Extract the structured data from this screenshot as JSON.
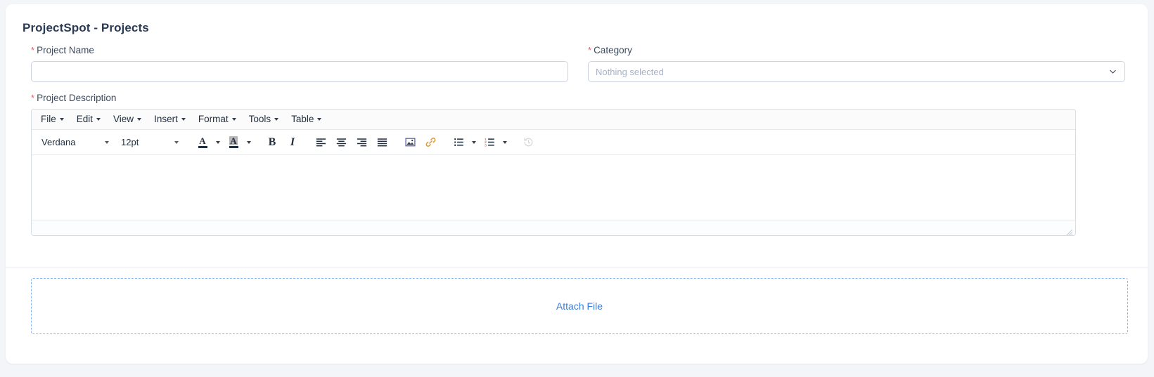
{
  "page": {
    "title": "ProjectSpot - Projects",
    "accent_blue": "#3b7ddd",
    "required_marker_color": "#e8606d",
    "dashed_border_color": "#84b6f0"
  },
  "form": {
    "project_name": {
      "label": "Project Name",
      "required_marker": "*",
      "value": "",
      "placeholder": ""
    },
    "category": {
      "label": "Category",
      "required_marker": "*",
      "selected_text": "Nothing selected",
      "caret_icon": "chevron-down-icon"
    },
    "project_description": {
      "label": "Project Description",
      "required_marker": "*"
    }
  },
  "editor": {
    "menubar": [
      {
        "label": "File",
        "caret": true
      },
      {
        "label": "Edit",
        "caret": true
      },
      {
        "label": "View",
        "caret": true
      },
      {
        "label": "Insert",
        "caret": true
      },
      {
        "label": "Format",
        "caret": true
      },
      {
        "label": "Tools",
        "caret": true
      },
      {
        "label": "Table",
        "caret": true
      }
    ],
    "toolbar": {
      "fontfamily": "Verdana",
      "fontsize": "12pt",
      "buttons": [
        {
          "name": "text-color-icon",
          "label": "A"
        },
        {
          "name": "background-color-icon",
          "label": "A"
        },
        {
          "name": "bold-icon",
          "label": "B"
        },
        {
          "name": "italic-icon",
          "label": "I"
        },
        {
          "name": "align-left-icon",
          "label": ""
        },
        {
          "name": "align-center-icon",
          "label": ""
        },
        {
          "name": "align-right-icon",
          "label": ""
        },
        {
          "name": "align-justify-icon",
          "label": ""
        },
        {
          "name": "image-icon",
          "label": ""
        },
        {
          "name": "link-icon",
          "label": ""
        },
        {
          "name": "bullet-list-icon",
          "label": ""
        },
        {
          "name": "numbered-list-icon",
          "label": ""
        },
        {
          "name": "restore-draft-icon",
          "label": ""
        }
      ]
    },
    "content": ""
  },
  "attach": {
    "label": "Attach File"
  }
}
